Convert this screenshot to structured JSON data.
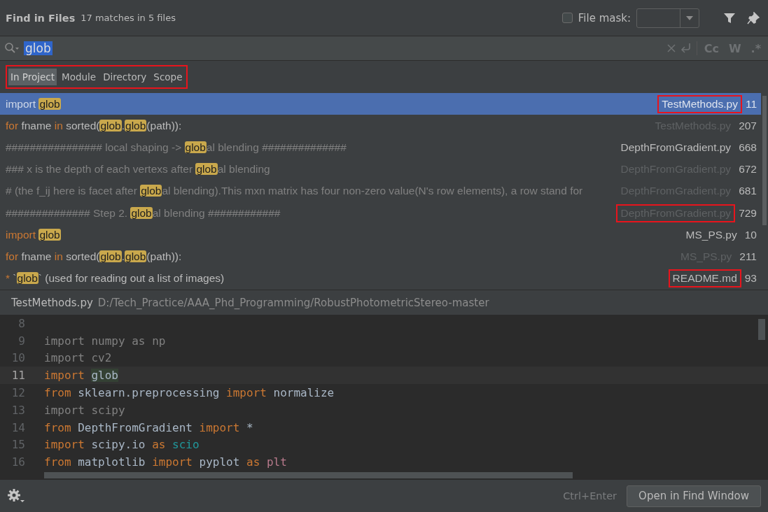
{
  "header": {
    "title": "Find in Files",
    "summary": "17 matches in 5 files",
    "file_mask": {
      "label": "File mask:",
      "checked": false
    }
  },
  "search": {
    "value": "glob",
    "options": [
      "Cc",
      "W",
      ".*"
    ]
  },
  "scopes": {
    "annotated": true,
    "items": [
      {
        "label": "In Project",
        "selected": true
      },
      {
        "label": "Module",
        "selected": false
      },
      {
        "label": "Directory",
        "selected": false
      },
      {
        "label": "Scope",
        "selected": false
      }
    ]
  },
  "results": [
    {
      "selected": true,
      "file": "TestMethods.py",
      "line": "11",
      "dimmed": false,
      "annotated": true,
      "parts": [
        {
          "kind": "kw",
          "text": "import "
        },
        {
          "kind": "match",
          "text": "glob"
        }
      ]
    },
    {
      "selected": false,
      "file": "TestMethods.py",
      "line": "207",
      "dimmed": true,
      "annotated": false,
      "parts": [
        {
          "kind": "kw",
          "text": "for "
        },
        {
          "kind": "plain",
          "text": "fname "
        },
        {
          "kind": "kw",
          "text": "in "
        },
        {
          "kind": "plain",
          "text": "sorted("
        },
        {
          "kind": "match",
          "text": "glob"
        },
        {
          "kind": "plain",
          "text": "."
        },
        {
          "kind": "match",
          "text": "glob"
        },
        {
          "kind": "plain",
          "text": "(path)):"
        }
      ]
    },
    {
      "selected": false,
      "file": "DepthFromGradient.py",
      "line": "668",
      "dimmed": false,
      "annotated": false,
      "parts": [
        {
          "kind": "comment",
          "text": "################ local shaping -> "
        },
        {
          "kind": "match",
          "text": "glob"
        },
        {
          "kind": "comment",
          "text": "al blending ##############"
        }
      ]
    },
    {
      "selected": false,
      "file": "DepthFromGradient.py",
      "line": "672",
      "dimmed": true,
      "annotated": false,
      "parts": [
        {
          "kind": "comment",
          "text": "### x is the depth of each vertexs after "
        },
        {
          "kind": "match",
          "text": "glob"
        },
        {
          "kind": "comment",
          "text": "al blending"
        }
      ]
    },
    {
      "selected": false,
      "file": "DepthFromGradient.py",
      "line": "681",
      "dimmed": true,
      "annotated": false,
      "parts": [
        {
          "kind": "comment",
          "text": "# (the f_ij here is facet after "
        },
        {
          "kind": "match",
          "text": "glob"
        },
        {
          "kind": "comment",
          "text": "al blending).This mxn matrix has four non-zero value(N's row elements), a row stand for"
        }
      ]
    },
    {
      "selected": false,
      "file": "DepthFromGradient.py",
      "line": "729",
      "dimmed": true,
      "annotated": true,
      "parts": [
        {
          "kind": "comment",
          "text": "############## Step 2. "
        },
        {
          "kind": "match",
          "text": "glob"
        },
        {
          "kind": "comment",
          "text": "al blending ############"
        }
      ]
    },
    {
      "selected": false,
      "file": "MS_PS.py",
      "line": "10",
      "dimmed": false,
      "annotated": false,
      "parts": [
        {
          "kind": "kw",
          "text": "import "
        },
        {
          "kind": "match",
          "text": "glob"
        }
      ]
    },
    {
      "selected": false,
      "file": "MS_PS.py",
      "line": "211",
      "dimmed": true,
      "annotated": false,
      "parts": [
        {
          "kind": "kw",
          "text": "for "
        },
        {
          "kind": "plain",
          "text": "fname "
        },
        {
          "kind": "kw",
          "text": "in "
        },
        {
          "kind": "plain",
          "text": "sorted("
        },
        {
          "kind": "match",
          "text": "glob"
        },
        {
          "kind": "plain",
          "text": "."
        },
        {
          "kind": "match",
          "text": "glob"
        },
        {
          "kind": "plain",
          "text": "(path)):"
        }
      ]
    },
    {
      "selected": false,
      "file": "README.md",
      "line": "93",
      "dimmed": false,
      "annotated": true,
      "parts": [
        {
          "kind": "kw",
          "text": "* "
        },
        {
          "kind": "plain",
          "text": "`"
        },
        {
          "kind": "match",
          "text": "glob"
        },
        {
          "kind": "plain",
          "text": "` (used for reading out a list of images)"
        }
      ]
    }
  ],
  "preview": {
    "file": "TestMethods.py",
    "path": "D:/Tech_Practice/AAA_Phd_Programming/RobustPhotometricStereo-master",
    "lines": [
      {
        "number": "8",
        "current": false
      },
      {
        "number": "9",
        "current": false,
        "tokens": [
          {
            "kind": "dim",
            "text": "import numpy as np"
          }
        ]
      },
      {
        "number": "10",
        "current": false,
        "tokens": [
          {
            "kind": "dim",
            "text": "import cv2"
          }
        ]
      },
      {
        "number": "11",
        "current": true,
        "tokens": [
          {
            "kind": "kw",
            "text": "import "
          },
          {
            "kind": "match",
            "text": "glob"
          }
        ]
      },
      {
        "number": "12",
        "current": false,
        "tokens": [
          {
            "kind": "kw",
            "text": "from "
          },
          {
            "kind": "plain",
            "text": "sklearn.preprocessing "
          },
          {
            "kind": "kw",
            "text": "import "
          },
          {
            "kind": "plain",
            "text": "normalize"
          }
        ]
      },
      {
        "number": "13",
        "current": false,
        "tokens": [
          {
            "kind": "dim",
            "text": "import scipy"
          }
        ]
      },
      {
        "number": "14",
        "current": false,
        "tokens": [
          {
            "kind": "kw",
            "text": "from "
          },
          {
            "kind": "plain",
            "text": "DepthFromGradient "
          },
          {
            "kind": "kw",
            "text": "import "
          },
          {
            "kind": "plain",
            "text": "*"
          }
        ]
      },
      {
        "number": "15",
        "current": false,
        "tokens": [
          {
            "kind": "kw",
            "text": "import "
          },
          {
            "kind": "plain",
            "text": "scipy.io "
          },
          {
            "kind": "kw",
            "text": "as "
          },
          {
            "kind": "alias",
            "text": "scio"
          }
        ]
      },
      {
        "number": "16",
        "current": false,
        "tokens": [
          {
            "kind": "kw",
            "text": "from "
          },
          {
            "kind": "plain",
            "text": "matplotlib "
          },
          {
            "kind": "kw",
            "text": "import "
          },
          {
            "kind": "plain",
            "text": "pyplot "
          },
          {
            "kind": "kw",
            "text": "as "
          },
          {
            "kind": "unused",
            "text": "plt"
          }
        ]
      }
    ]
  },
  "footer": {
    "shortcut": "Ctrl+Enter",
    "button": "Open in Find Window"
  }
}
